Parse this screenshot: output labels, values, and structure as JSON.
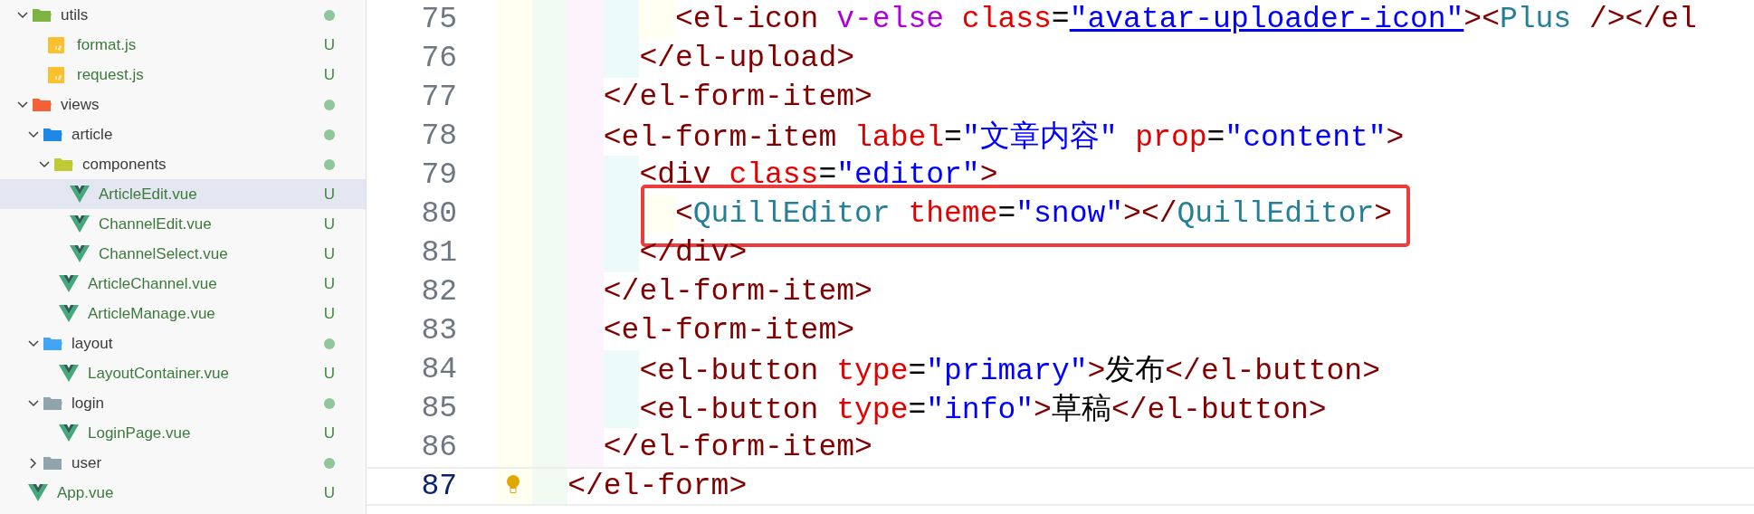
{
  "explorer": {
    "items": [
      {
        "kind": "folder",
        "name": "utils",
        "expanded": true,
        "color": "#7cb342",
        "dot": true,
        "children": [
          {
            "kind": "js",
            "name": "format.js",
            "status": "U",
            "selected": false
          },
          {
            "kind": "js",
            "name": "request.js",
            "status": "U",
            "selected": false
          }
        ]
      },
      {
        "kind": "folder",
        "name": "views",
        "expanded": true,
        "color": "#f4623a",
        "dot": true,
        "children": [
          {
            "kind": "folder",
            "name": "article",
            "expanded": true,
            "color": "#1e88e5",
            "dot": true,
            "children": [
              {
                "kind": "folder",
                "name": "components",
                "expanded": true,
                "color": "#c0ca33",
                "dot": true,
                "children": [
                  {
                    "kind": "vue",
                    "name": "ArticleEdit.vue",
                    "status": "U",
                    "selected": true
                  },
                  {
                    "kind": "vue",
                    "name": "ChannelEdit.vue",
                    "status": "U",
                    "selected": false
                  },
                  {
                    "kind": "vue",
                    "name": "ChannelSelect.vue",
                    "status": "U",
                    "selected": false
                  }
                ]
              },
              {
                "kind": "vue",
                "name": "ArticleChannel.vue",
                "status": "U",
                "selected": false
              },
              {
                "kind": "vue",
                "name": "ArticleManage.vue",
                "status": "U",
                "selected": false
              }
            ]
          },
          {
            "kind": "folder",
            "name": "layout",
            "expanded": true,
            "color": "#42a5f5",
            "dot": true,
            "children": [
              {
                "kind": "vue",
                "name": "LayoutContainer.vue",
                "status": "U",
                "selected": false
              }
            ]
          },
          {
            "kind": "folder",
            "name": "login",
            "expanded": true,
            "color": "#90a4ae",
            "dot": true,
            "children": [
              {
                "kind": "vue",
                "name": "LoginPage.vue",
                "status": "U",
                "selected": false
              }
            ]
          },
          {
            "kind": "folder",
            "name": "user",
            "expanded": false,
            "color": "#90a4ae",
            "dot": true
          }
        ]
      },
      {
        "kind": "vue",
        "name": "App.vue",
        "status": "U",
        "selected": false
      }
    ]
  },
  "editor": {
    "lines": [
      {
        "number": "75",
        "current": false,
        "highlighted": false,
        "tokens": [
          {
            "kind": "tag",
            "s": "          <el-icon"
          },
          {
            "kind": "directive",
            "s": " v-else"
          },
          {
            "kind": "attr",
            "s": " class"
          },
          {
            "kind": "eq",
            "s": "="
          },
          {
            "kind": "link",
            "s": "\"avatar-uploader-icon\""
          },
          {
            "kind": "tag",
            "s": "><"
          },
          {
            "kind": "comp",
            "s": "Plus"
          },
          {
            "kind": "tag",
            "s": " /></el"
          }
        ]
      },
      {
        "number": "76",
        "current": false,
        "highlighted": false,
        "tokens": [
          {
            "kind": "tag",
            "s": "        </el-upload>"
          }
        ]
      },
      {
        "number": "77",
        "current": false,
        "highlighted": false,
        "tokens": [
          {
            "kind": "tag",
            "s": "      </el-form-item>"
          }
        ]
      },
      {
        "number": "78",
        "current": false,
        "highlighted": false,
        "tokens": [
          {
            "kind": "tag",
            "s": "      <el-form-item"
          },
          {
            "kind": "attr",
            "s": " label"
          },
          {
            "kind": "eq",
            "s": "="
          },
          {
            "kind": "str",
            "s": "\"文章内容\""
          },
          {
            "kind": "attr",
            "s": " prop"
          },
          {
            "kind": "eq",
            "s": "="
          },
          {
            "kind": "str",
            "s": "\"content\""
          },
          {
            "kind": "tag",
            "s": ">"
          }
        ]
      },
      {
        "number": "79",
        "current": false,
        "highlighted": false,
        "tokens": [
          {
            "kind": "tag",
            "s": "        <div"
          },
          {
            "kind": "attr",
            "s": " class"
          },
          {
            "kind": "eq",
            "s": "="
          },
          {
            "kind": "str",
            "s": "\"editor\""
          },
          {
            "kind": "tag",
            "s": ">"
          }
        ]
      },
      {
        "number": "80",
        "current": false,
        "highlighted": true,
        "tokens": [
          {
            "kind": "tag",
            "s": "          <"
          },
          {
            "kind": "comp",
            "s": "QuillEditor"
          },
          {
            "kind": "attr",
            "s": " theme"
          },
          {
            "kind": "eq",
            "s": "="
          },
          {
            "kind": "str",
            "s": "\"snow\""
          },
          {
            "kind": "tag",
            "s": "></"
          },
          {
            "kind": "comp",
            "s": "QuillEditor"
          },
          {
            "kind": "tag",
            "s": ">"
          }
        ]
      },
      {
        "number": "81",
        "current": false,
        "highlighted": false,
        "tokens": [
          {
            "kind": "tag",
            "s": "        </div>"
          }
        ]
      },
      {
        "number": "82",
        "current": false,
        "highlighted": false,
        "tokens": [
          {
            "kind": "tag",
            "s": "      </el-form-item>"
          }
        ]
      },
      {
        "number": "83",
        "current": false,
        "highlighted": false,
        "tokens": [
          {
            "kind": "tag",
            "s": "      <el-form-item>"
          }
        ]
      },
      {
        "number": "84",
        "current": false,
        "highlighted": false,
        "tokens": [
          {
            "kind": "tag",
            "s": "        <el-button"
          },
          {
            "kind": "attr",
            "s": " type"
          },
          {
            "kind": "eq",
            "s": "="
          },
          {
            "kind": "str",
            "s": "\"primary\""
          },
          {
            "kind": "tag",
            "s": ">"
          },
          {
            "kind": "text",
            "s": "发布"
          },
          {
            "kind": "tag",
            "s": "</el-button>"
          }
        ]
      },
      {
        "number": "85",
        "current": false,
        "highlighted": false,
        "tokens": [
          {
            "kind": "tag",
            "s": "        <el-button"
          },
          {
            "kind": "attr",
            "s": " type"
          },
          {
            "kind": "eq",
            "s": "="
          },
          {
            "kind": "str",
            "s": "\"info\""
          },
          {
            "kind": "tag",
            "s": ">"
          },
          {
            "kind": "text",
            "s": "草稿"
          },
          {
            "kind": "tag",
            "s": "</el-button>"
          }
        ]
      },
      {
        "number": "86",
        "current": false,
        "highlighted": false,
        "tokens": [
          {
            "kind": "tag",
            "s": "      </el-form-item>"
          }
        ]
      },
      {
        "number": "87",
        "current": true,
        "highlighted": false,
        "tokens": [
          {
            "kind": "tag",
            "s": "    </el-form>"
          }
        ]
      }
    ]
  }
}
